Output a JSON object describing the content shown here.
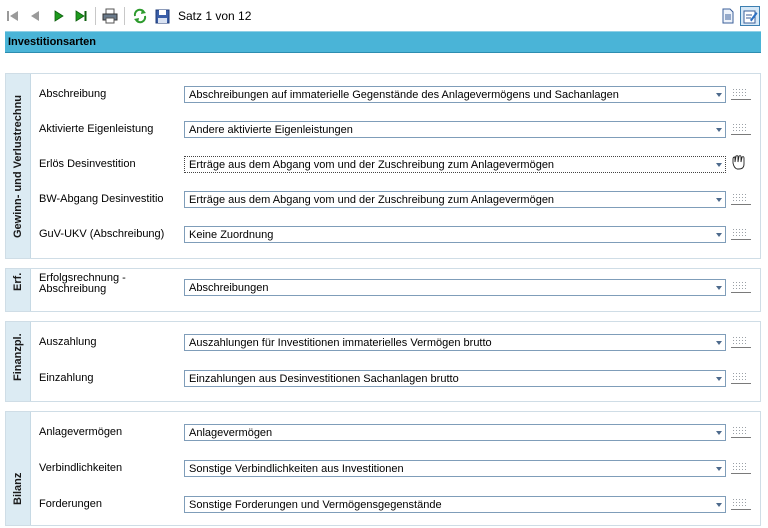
{
  "toolbar": {
    "record_status": "Satz 1 von 12",
    "icons": [
      "first-record-icon",
      "previous-record-icon",
      "next-record-icon",
      "last-record-icon",
      "print-icon",
      "refresh-icon",
      "save-icon",
      "document-view-icon",
      "edit-form-icon"
    ]
  },
  "panel": {
    "title": "Investitionsarten"
  },
  "groups": [
    {
      "label": "Gewinn- und Verlustrechnu",
      "rows": [
        {
          "label": "Abschreibung",
          "value": "Abschreibungen auf immaterielle Gegenstände des Anlagevermögens und Sachanlagen"
        },
        {
          "label": "Aktivierte Eigenleistung",
          "value": "Andere aktivierte Eigenleistungen"
        },
        {
          "label": "Erlös Desinvestition",
          "value": "Erträge aus dem Abgang vom und der Zuschreibung zum Anlagevermögen"
        },
        {
          "label": "BW-Abgang Desinvestitio",
          "value": "Erträge aus dem Abgang vom und der Zuschreibung zum Anlagevermögen"
        },
        {
          "label": "GuV-UKV (Abschreibung)",
          "value": "Keine Zuordnung"
        }
      ]
    },
    {
      "label": "Erf.",
      "rows": [
        {
          "label": "Erfolgsrechnung - Abschreibung",
          "value": "Abschreibungen"
        }
      ]
    },
    {
      "label": "Finanzpl.",
      "rows": [
        {
          "label": "Auszahlung",
          "value": "Auszahlungen für Investitionen immaterielles Vermögen brutto"
        },
        {
          "label": "Einzahlung",
          "value": "Einzahlungen aus Desinvestitionen Sachanlagen brutto"
        }
      ]
    },
    {
      "label": "Bilanz",
      "rows": [
        {
          "label": "Anlagevermögen",
          "value": "Anlagevermögen"
        },
        {
          "label": "Verbindlichkeiten",
          "value": "Sonstige Verbindlichkeiten aus Investitionen"
        },
        {
          "label": "Forderungen",
          "value": "Sonstige Forderungen und Vermögensgegenstände"
        }
      ]
    }
  ],
  "colors": {
    "title_bar": "#4ab4d7",
    "group_tab": "#dcebf3",
    "combo_border": "#7f9db9",
    "nav_green": "#1e9a1e"
  }
}
